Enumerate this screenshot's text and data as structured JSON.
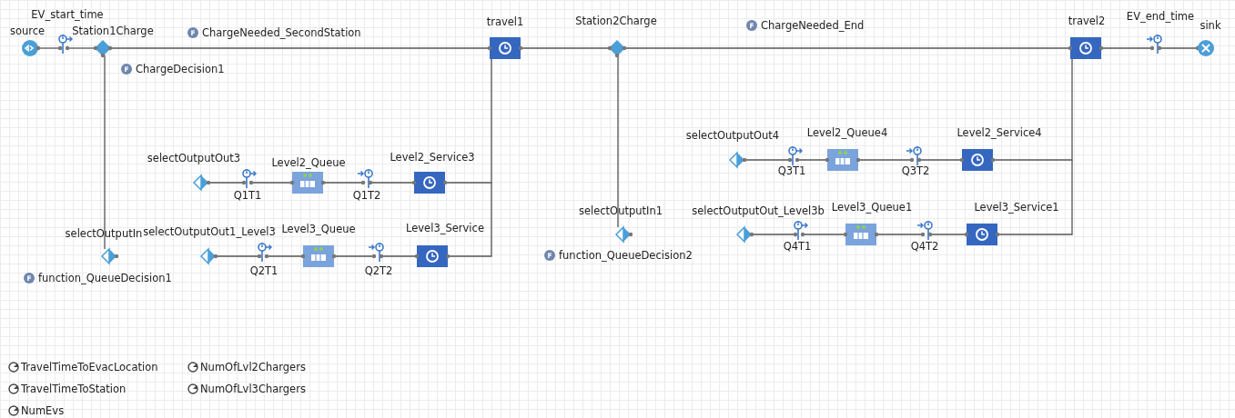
{
  "blocks": [
    {
      "kind": "source",
      "label": "source"
    },
    {
      "kind": "time_start",
      "label": "EV_start_time"
    },
    {
      "kind": "select",
      "label": "Station1Charge"
    },
    {
      "kind": "delay",
      "label": "travel1"
    },
    {
      "kind": "select",
      "label": "Station2Charge"
    },
    {
      "kind": "delay",
      "label": "travel2"
    },
    {
      "kind": "time_end",
      "label": "EV_end_time"
    },
    {
      "kind": "sink",
      "label": "sink"
    },
    {
      "kind": "select_out",
      "label": "selectOutputOut3"
    },
    {
      "kind": "time_start",
      "label": "Q1T1"
    },
    {
      "kind": "queue",
      "label": "Level2_Queue"
    },
    {
      "kind": "time_end",
      "label": "Q1T2"
    },
    {
      "kind": "delay",
      "label": "Level2_Service3"
    },
    {
      "kind": "select_out",
      "label": "selectOutputIn"
    },
    {
      "kind": "select_out",
      "label": "selectOutputOut1_Level3"
    },
    {
      "kind": "time_start",
      "label": "Q2T1"
    },
    {
      "kind": "queue",
      "label": "Level3_Queue"
    },
    {
      "kind": "time_end",
      "label": "Q2T2"
    },
    {
      "kind": "delay",
      "label": "Level3_Service"
    },
    {
      "kind": "select_out",
      "label": "selectOutputIn1"
    },
    {
      "kind": "select_out",
      "label": "selectOutputOut4"
    },
    {
      "kind": "time_start",
      "label": "Q3T1"
    },
    {
      "kind": "queue",
      "label": "Level2_Queue4"
    },
    {
      "kind": "time_end",
      "label": "Q3T2"
    },
    {
      "kind": "delay",
      "label": "Level2_Service4"
    },
    {
      "kind": "select_out",
      "label": "selectOutputOut_Level3b"
    },
    {
      "kind": "time_start",
      "label": "Q4T1"
    },
    {
      "kind": "queue",
      "label": "Level3_Queue1"
    },
    {
      "kind": "time_end",
      "label": "Q4T2"
    },
    {
      "kind": "delay",
      "label": "Level3_Service1"
    }
  ],
  "functions": [
    {
      "icon": "F",
      "label": "ChargeNeeded_SecondStation"
    },
    {
      "icon": "F",
      "label": "ChargeDecision1"
    },
    {
      "icon": "F",
      "label": "ChargeNeeded_End"
    },
    {
      "icon": "F",
      "label": "function_QueueDecision1"
    },
    {
      "icon": "F",
      "label": "function_QueueDecision2"
    }
  ],
  "parameters": [
    {
      "label": "TravelTimeToEvacLocation"
    },
    {
      "label": "TravelTimeToStation"
    },
    {
      "label": "NumEvs"
    },
    {
      "label": "NumOfLvl2Chargers"
    },
    {
      "label": "NumOfLvl3Chargers"
    }
  ]
}
